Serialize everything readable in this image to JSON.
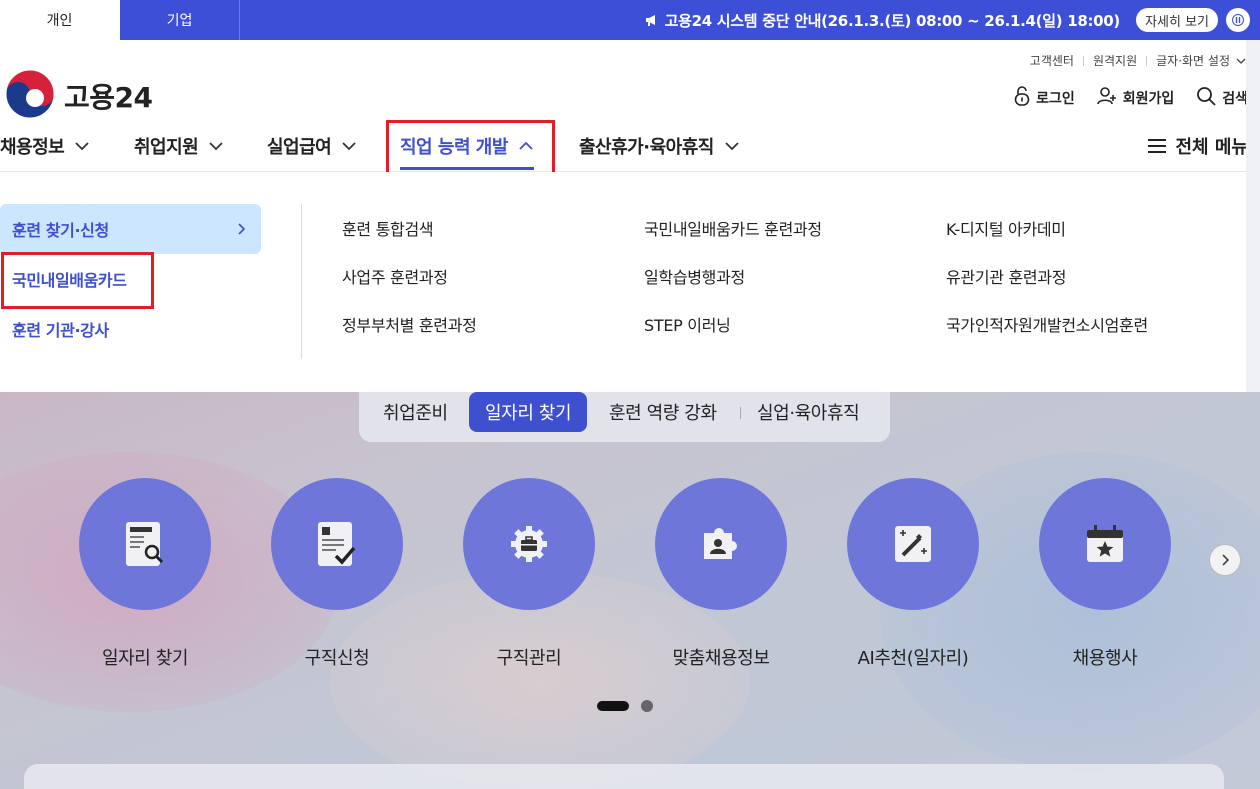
{
  "topbar": {
    "tabs": [
      "개인",
      "기업"
    ],
    "notice": "고용24 시스템 중단 안내(26.1.3.(토) 08:00 ~ 26.1.4(일) 18:00)",
    "detail_label": "자세히 보기",
    "colors": {
      "bar": "#3d4fd6"
    }
  },
  "util_links": [
    "고객센터",
    "원격지원",
    "글자·화면 설정"
  ],
  "logo": {
    "text": "고용24"
  },
  "member": {
    "login": "로그인",
    "join": "회원가입",
    "search": "검색"
  },
  "gnb": {
    "items": [
      "채용정보",
      "취업지원",
      "실업급여",
      "직업 능력 개발",
      "출산휴가·육아휴직"
    ],
    "active_index": 3,
    "all_menu": "전체 메뉴",
    "accent": "#3e4fcf"
  },
  "dropdown": {
    "side": [
      "훈련 찾기·신청",
      "국민내일배움카드",
      "훈련 기관·강사"
    ],
    "col1": [
      "훈련 통합검색",
      "사업주 훈련과정",
      "정부부처별 훈련과정"
    ],
    "col2": [
      "국민내일배움카드 훈련과정",
      "일학습병행과정",
      "STEP 이러닝"
    ],
    "col3": [
      "K-디지털 아카데미",
      "유관기관 훈련과정",
      "국가인적자원개발컨소시엄훈련"
    ]
  },
  "segment": {
    "items": [
      "취업준비",
      "일자리 찾기",
      "훈련 역량 강화",
      "실업·육아휴직"
    ],
    "active_index": 1
  },
  "services": [
    {
      "label": "일자리 찾기",
      "icon": "document-search-icon"
    },
    {
      "label": "구직신청",
      "icon": "document-check-icon"
    },
    {
      "label": "구직관리",
      "icon": "gear-briefcase-icon"
    },
    {
      "label": "맞춤채용정보",
      "icon": "puzzle-person-icon"
    },
    {
      "label": "AI추천(일자리)",
      "icon": "magic-wand-icon"
    },
    {
      "label": "채용행사",
      "icon": "calendar-star-icon"
    }
  ],
  "carousel": {
    "page": 1,
    "pages": 2
  }
}
